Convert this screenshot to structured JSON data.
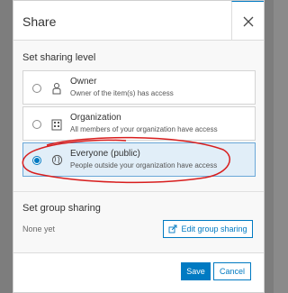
{
  "dialog": {
    "title": "Share",
    "close_icon": "close-icon"
  },
  "sharing_level": {
    "label": "Set sharing level",
    "options": [
      {
        "name": "Owner",
        "description": "Owner of the item(s) has access",
        "icon": "person-icon",
        "selected": false
      },
      {
        "name": "Organization",
        "description": "All members of your organization have access",
        "icon": "building-icon",
        "selected": false
      },
      {
        "name": "Everyone (public)",
        "description": "People outside your organization have access",
        "icon": "globe-icon",
        "selected": true
      }
    ]
  },
  "group_sharing": {
    "label": "Set group sharing",
    "status": "None yet",
    "edit_button": "Edit group sharing"
  },
  "footer": {
    "save_label": "Save",
    "cancel_label": "Cancel"
  },
  "colors": {
    "accent": "#007ac2",
    "selected_bg": "#e1eef8",
    "annotation": "#d81e1e"
  }
}
